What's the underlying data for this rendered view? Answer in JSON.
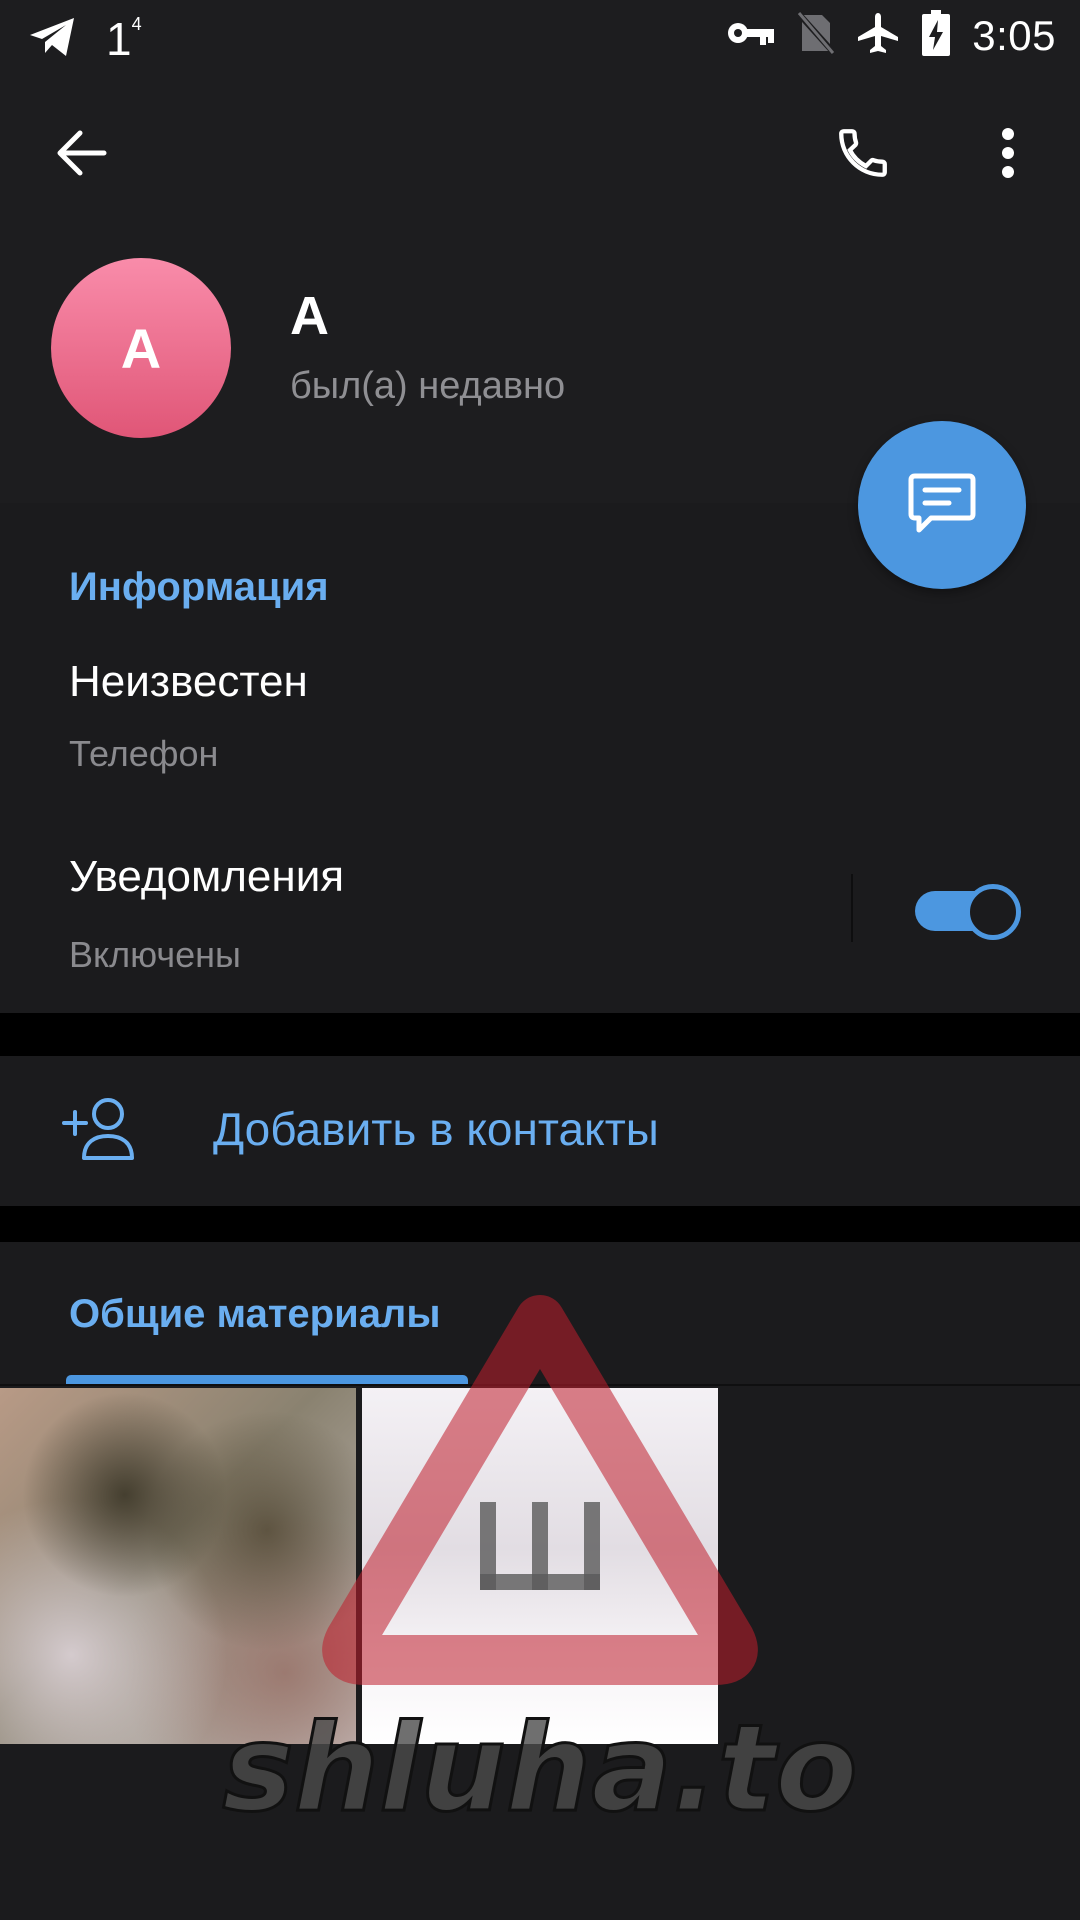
{
  "status_bar": {
    "notification_count": "1",
    "notification_sup": "4",
    "time": "3:05",
    "icons": [
      "telegram-icon",
      "vpn-key-icon",
      "no-sim-icon",
      "airplane-icon",
      "battery-charging-icon"
    ]
  },
  "app_bar": {
    "icons": [
      "back-arrow-icon",
      "phone-icon",
      "more-vert-icon"
    ]
  },
  "profile": {
    "avatar_letter": "A",
    "name": "A",
    "status": "был(а) недавно",
    "avatar_colors": [
      "#f98caa",
      "#e05677"
    ]
  },
  "info": {
    "title": "Информация",
    "phone_value": "Неизвестен",
    "phone_label": "Телефон",
    "notifications_title": "Уведомления",
    "notifications_value": "Включены",
    "notifications_enabled": true
  },
  "actions": {
    "add_contact": "Добавить в контакты"
  },
  "media": {
    "title": "Общие материалы"
  },
  "watermark": {
    "text": "shluha.to",
    "sign_letter": "Ш"
  },
  "colors": {
    "accent": "#4c97e0",
    "accent_text": "#6aaef0",
    "background": "#1b1b1d",
    "secondary_text": "#8a8a8e"
  }
}
